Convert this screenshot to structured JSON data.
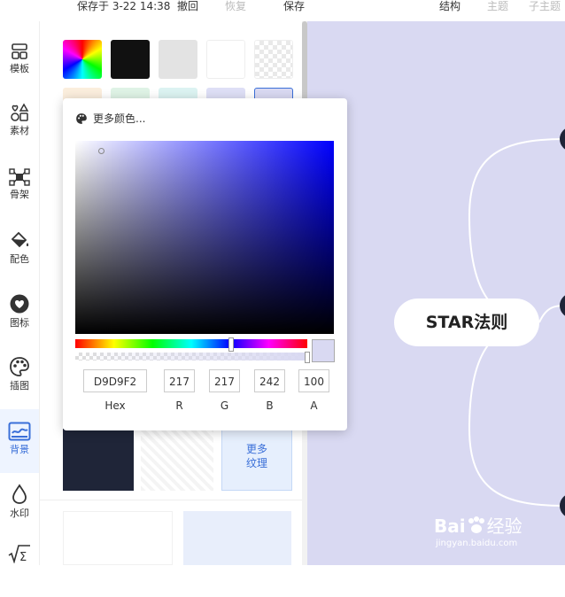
{
  "topbar": {
    "saved": "保存于 3-22 14:38",
    "undo": "撤回",
    "redo": "恢复",
    "save": "保存",
    "structure": "结构",
    "theme": "主题",
    "subtheme": "子主题"
  },
  "sidebar": {
    "items": [
      {
        "label": "模板",
        "icon": "template-icon"
      },
      {
        "label": "素材",
        "icon": "shapes-icon"
      },
      {
        "label": "骨架",
        "icon": "skeleton-icon"
      },
      {
        "label": "配色",
        "icon": "paint-bucket-icon"
      },
      {
        "label": "图标",
        "icon": "heart-icon"
      },
      {
        "label": "插图",
        "icon": "palette-icon"
      },
      {
        "label": "背景",
        "icon": "background-icon",
        "active": true
      },
      {
        "label": "水印",
        "icon": "drop-icon"
      },
      {
        "label": "",
        "icon": "formula-icon"
      }
    ]
  },
  "panel": {
    "more_texture": "更多\n纹理"
  },
  "picker": {
    "title": "更多颜色...",
    "hex": "D9D9F2",
    "r": "217",
    "g": "217",
    "b": "242",
    "a": "100",
    "labels": {
      "hex": "Hex",
      "r": "R",
      "g": "G",
      "b": "B",
      "a": "A"
    },
    "hue_fraction": 0.667,
    "alpha_fraction": 1.0,
    "sat_fraction": 0.1,
    "val_fraction": 0.95
  },
  "canvas": {
    "root_label": "STAR法则",
    "background": "#d9d9f2"
  },
  "watermark": {
    "brand": "Bai",
    "brand2": "经验",
    "url": "jingyan.baidu.com"
  },
  "colors": {
    "accent": "#3a6fd8",
    "selected": "#d9d9f2"
  }
}
